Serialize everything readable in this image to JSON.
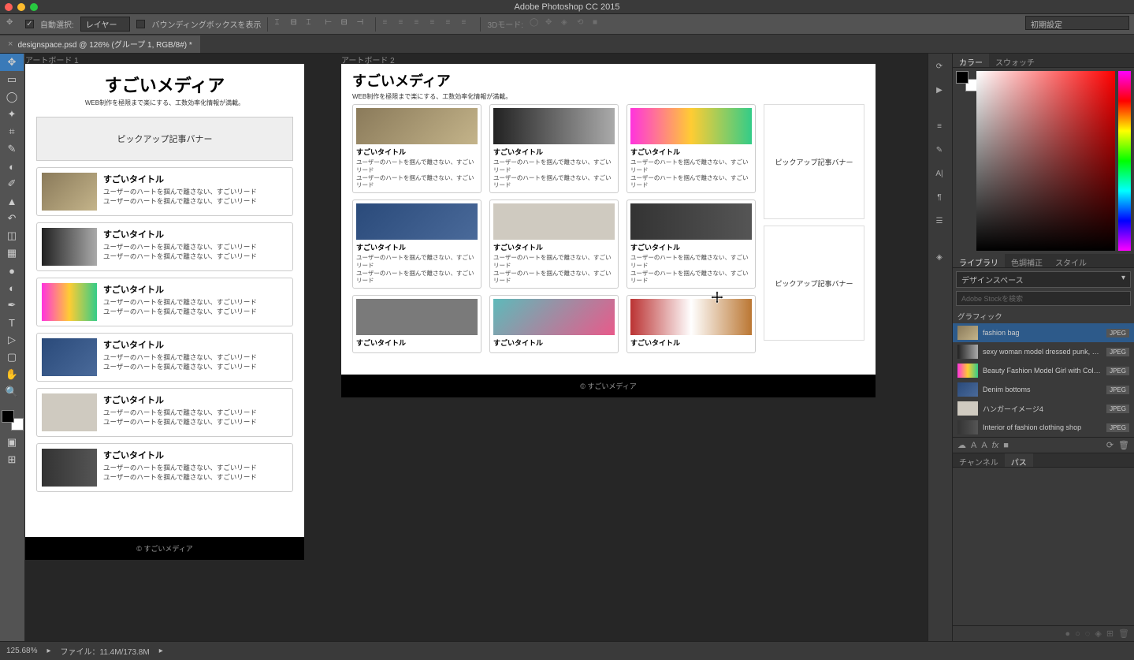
{
  "app": {
    "title": "Adobe Photoshop CC 2015"
  },
  "optbar": {
    "auto_select": "自動選択:",
    "layer": "レイヤー",
    "bounding": "バウンディングボックスを表示",
    "mode3d": "3Dモード:",
    "preset": "初期設定"
  },
  "doc": {
    "tab": "designspace.psd @ 126% (グループ 1, RGB/8#) *"
  },
  "artboards": {
    "ab1": "アートボード 1",
    "ab2": "アートボード 2"
  },
  "site": {
    "title": "すごいメディア",
    "subtitle": "WEB制作を極限まで楽にする、工数効率化情報が満載。",
    "pickup": "ピックアップ記事バナー",
    "card_title": "すごいタイトル",
    "card_lead": "ユーザーのハートを掴んで離さない、すごいリード",
    "card_lead_short": "ユーザーのハートを掴んで離さない、すごいリード",
    "footer": "© すごいメディア"
  },
  "panels": {
    "color": "カラー",
    "swatches": "スウォッチ",
    "library": "ライブラリ",
    "hue_saturation": "色調補正",
    "styles": "スタイル",
    "channels": "チャンネル",
    "paths": "パス",
    "library_select": "デザインスペース",
    "search_placeholder": "Adobe Stockを検索",
    "graphic_header": "グラフィック"
  },
  "library_items": [
    {
      "name": "fashion bag",
      "format": "JPEG",
      "thumb": "th-bag"
    },
    {
      "name": "sexy woman model dressed punk, wet ...",
      "format": "JPEG",
      "thumb": "th-model"
    },
    {
      "name": "Beauty Fashion Model Girl with Colorfu...",
      "format": "JPEG",
      "thumb": "th-hair"
    },
    {
      "name": "Denim bottoms",
      "format": "JPEG",
      "thumb": "th-denim"
    },
    {
      "name": "ハンガーイメージ4",
      "format": "JPEG",
      "thumb": "th-hanger"
    },
    {
      "name": "Interior of fashion clothing shop",
      "format": "JPEG",
      "thumb": "th-shop"
    }
  ],
  "status": {
    "zoom": "125.68%",
    "file": "ファイル：11.4M/173.8M"
  }
}
